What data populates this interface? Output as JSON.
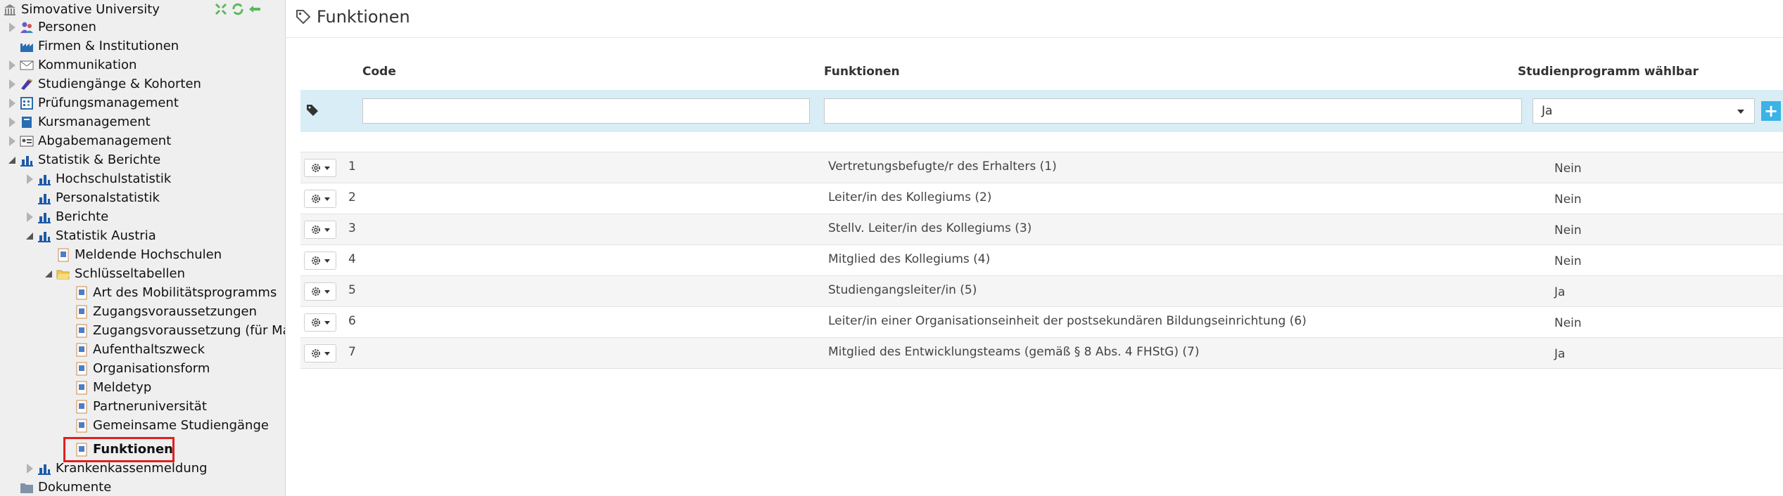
{
  "sidebar": {
    "root": {
      "label": "Simovative University"
    },
    "items": [
      {
        "label": "Personen",
        "icon": "persons-icon"
      },
      {
        "label": "Firmen & Institutionen",
        "icon": "factory-icon"
      },
      {
        "label": "Kommunikation",
        "icon": "envelope-icon"
      },
      {
        "label": "Studiengänge & Kohorten",
        "icon": "graduation-icon"
      },
      {
        "label": "Prüfungsmanagement",
        "icon": "exam-calendar-icon"
      },
      {
        "label": "Kursmanagement",
        "icon": "book-icon"
      },
      {
        "label": "Abgabemanagement",
        "icon": "id-card-icon"
      },
      {
        "label": "Statistik & Berichte",
        "icon": "bar-chart-icon"
      },
      {
        "label": "Hochschulstatistik",
        "icon": "bar-chart-icon"
      },
      {
        "label": "Personalstatistik",
        "icon": "bar-chart-icon"
      },
      {
        "label": "Berichte",
        "icon": "bar-chart-icon"
      },
      {
        "label": "Statistik Austria",
        "icon": "bar-chart-icon"
      },
      {
        "label": "Meldende Hochschulen",
        "icon": "document-icon"
      },
      {
        "label": "Schlüsseltabellen",
        "icon": "folder-open-icon"
      },
      {
        "label": "Art des Mobilitätsprogramms",
        "icon": "document-icon"
      },
      {
        "label": "Zugangsvoraussetzungen",
        "icon": "document-icon"
      },
      {
        "label": "Zugangsvoraussetzung (für Maste",
        "icon": "document-icon"
      },
      {
        "label": "Aufenthaltszweck",
        "icon": "document-icon"
      },
      {
        "label": "Organisationsform",
        "icon": "document-icon"
      },
      {
        "label": "Meldetyp",
        "icon": "document-icon"
      },
      {
        "label": "Partneruniversität",
        "icon": "document-icon"
      },
      {
        "label": "Gemeinsame Studiengänge",
        "icon": "document-icon"
      },
      {
        "label": "Funktionen",
        "icon": "document-icon"
      },
      {
        "label": "Krankenkassenmeldung",
        "icon": "bar-chart-icon"
      },
      {
        "label": "Dokumente",
        "icon": "folder-icon"
      }
    ]
  },
  "page": {
    "title": "Funktionen"
  },
  "table": {
    "headers": {
      "code": "Code",
      "funktionen": "Funktionen",
      "studienprogramm": "Studienprogramm wählbar"
    },
    "filter": {
      "select_value": "Ja",
      "add_label": "+"
    },
    "rows": [
      {
        "code": "1",
        "funktion": "Vertretungsbefugte/r des Erhalters (1)",
        "waehlbar": "Nein"
      },
      {
        "code": "2",
        "funktion": "Leiter/in des Kollegiums (2)",
        "waehlbar": "Nein"
      },
      {
        "code": "3",
        "funktion": "Stellv. Leiter/in des Kollegiums (3)",
        "waehlbar": "Nein"
      },
      {
        "code": "4",
        "funktion": "Mitglied des Kollegiums (4)",
        "waehlbar": "Nein"
      },
      {
        "code": "5",
        "funktion": "Studiengangsleiter/in (5)",
        "waehlbar": "Ja"
      },
      {
        "code": "6",
        "funktion": "Leiter/in einer Organisationseinheit der postsekundären Bildungseinrichtung (6)",
        "waehlbar": "Nein"
      },
      {
        "code": "7",
        "funktion": "Mitglied des Entwicklungsteams (gemäß § 8 Abs. 4 FHStG) (7)",
        "waehlbar": "Ja"
      }
    ]
  }
}
